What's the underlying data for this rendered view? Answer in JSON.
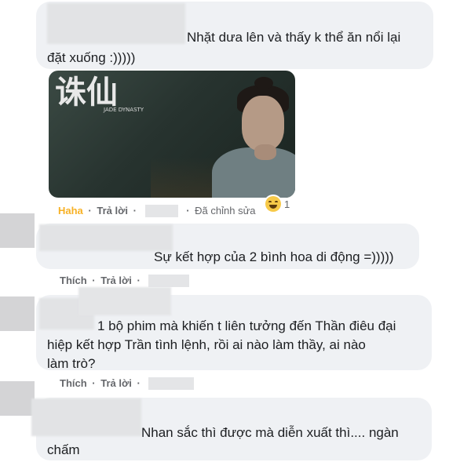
{
  "comments": [
    {
      "text_lines": [
        "Nhặt dưa lên và thấy k thể ăn nổi lại",
        "đặt xuống :)))))"
      ],
      "image": {
        "alt": "Tru Tiên",
        "logo_text": "诛仙",
        "logo_sub": "JADE DYNASTY"
      },
      "actions": {
        "reaction_label": "Haha",
        "reply_label": "Trả lời",
        "edited_label": "Đã chỉnh sửa"
      },
      "reaction_count": "1"
    },
    {
      "text_lines": [
        "Sự kết hợp của 2 bình hoa di động =)))))"
      ],
      "actions": {
        "like_label": "Thích",
        "reply_label": "Trả lời"
      }
    },
    {
      "text_lines": [
        "1 bộ phim mà khiến t liên tưởng đến Thần điêu đại",
        "hiệp kết hợp Trần tình lệnh, rồi ai nào làm thầy, ai nào",
        "làm trò?"
      ],
      "actions": {
        "like_label": "Thích",
        "reply_label": "Trả lời"
      }
    },
    {
      "text_lines": [
        "Nhan sắc thì được mà diễn xuất thì.... ngàn",
        "chấm"
      ]
    }
  ],
  "colors": {
    "bubble": "#eff1f4",
    "meta": "#65676b",
    "haha": "#f7b125"
  }
}
